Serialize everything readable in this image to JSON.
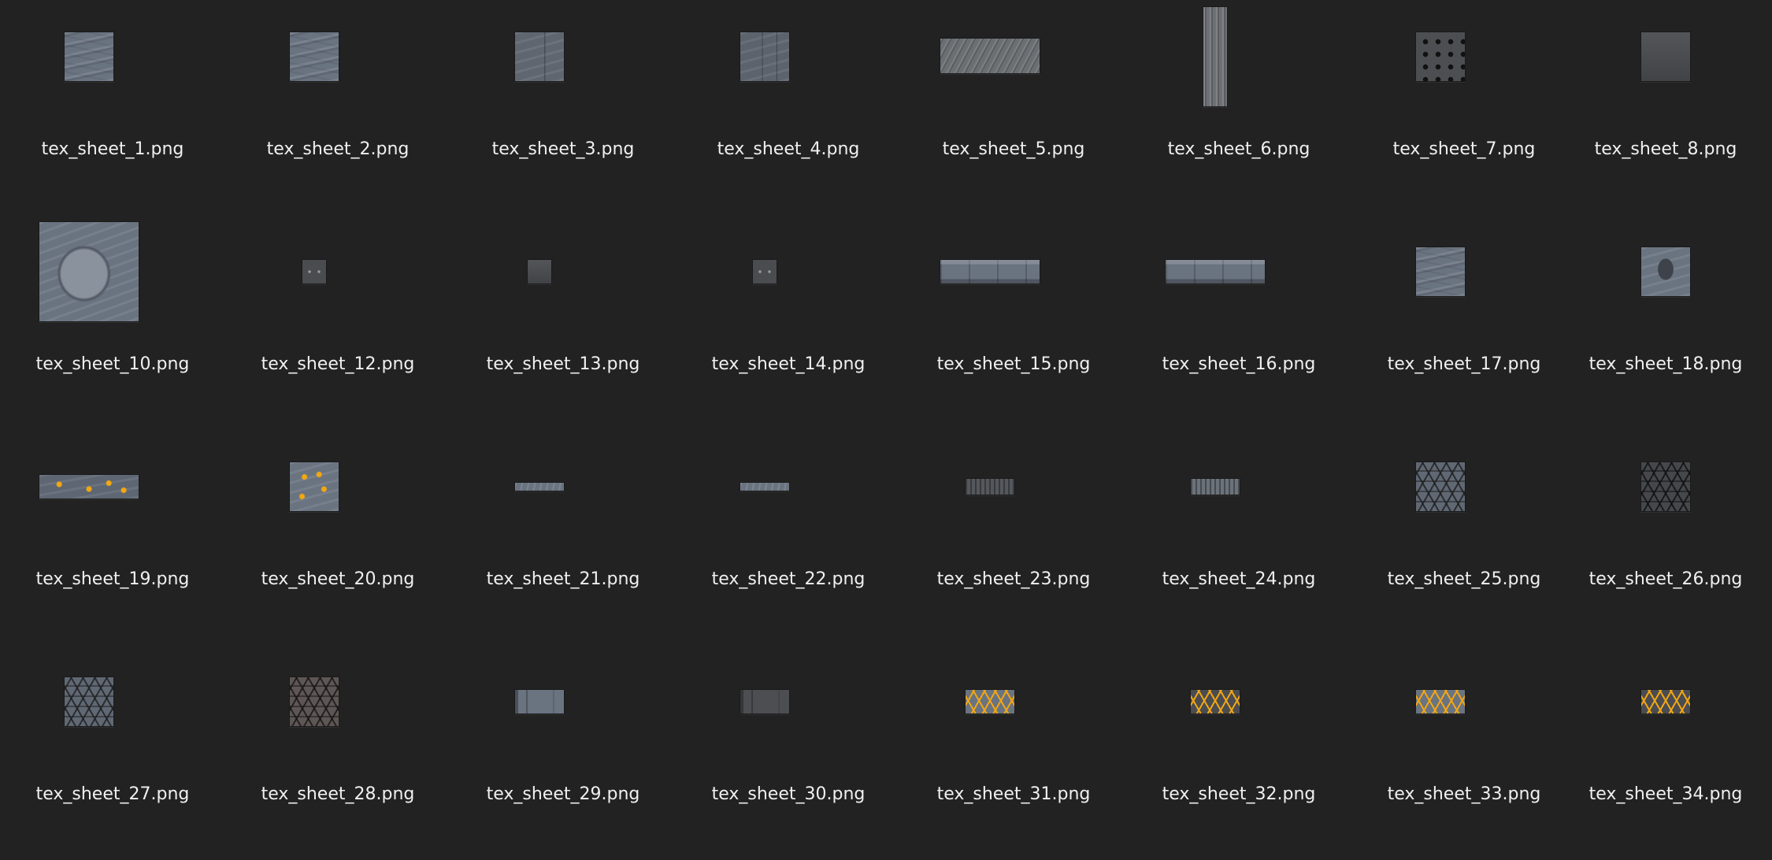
{
  "files": [
    {
      "name": "tex_sheet_1.png",
      "texture": "stone"
    },
    {
      "name": "tex_sheet_2.png",
      "texture": "stone"
    },
    {
      "name": "tex_sheet_3.png",
      "texture": "panel"
    },
    {
      "name": "tex_sheet_4.png",
      "texture": "panel-2"
    },
    {
      "name": "tex_sheet_5.png",
      "texture": "plank"
    },
    {
      "name": "tex_sheet_6.png",
      "texture": "plank-vertical"
    },
    {
      "name": "tex_sheet_7.png",
      "texture": "dots"
    },
    {
      "name": "tex_sheet_8.png",
      "texture": "metal-dark"
    },
    {
      "name": "tex_sheet_10.png",
      "texture": "boulder"
    },
    {
      "name": "tex_sheet_12.png",
      "texture": "small-dark"
    },
    {
      "name": "tex_sheet_13.png",
      "texture": "metal-dark"
    },
    {
      "name": "tex_sheet_14.png",
      "texture": "small-dark"
    },
    {
      "name": "tex_sheet_15.png",
      "texture": "bar"
    },
    {
      "name": "tex_sheet_16.png",
      "texture": "bar"
    },
    {
      "name": "tex_sheet_17.png",
      "texture": "stone"
    },
    {
      "name": "tex_sheet_18.png",
      "texture": "shrine"
    },
    {
      "name": "tex_sheet_19.png",
      "texture": "lava"
    },
    {
      "name": "tex_sheet_20.png",
      "texture": "lava-stone"
    },
    {
      "name": "tex_sheet_21.png",
      "texture": "thin"
    },
    {
      "name": "tex_sheet_22.png",
      "texture": "thin"
    },
    {
      "name": "tex_sheet_23.png",
      "texture": "grate"
    },
    {
      "name": "tex_sheet_24.png",
      "texture": "grate-light"
    },
    {
      "name": "tex_sheet_25.png",
      "texture": "hex"
    },
    {
      "name": "tex_sheet_26.png",
      "texture": "hex-dark"
    },
    {
      "name": "tex_sheet_27.png",
      "texture": "hex"
    },
    {
      "name": "tex_sheet_28.png",
      "texture": "hex-brown"
    },
    {
      "name": "tex_sheet_29.png",
      "texture": "block"
    },
    {
      "name": "tex_sheet_30.png",
      "texture": "block-dark"
    },
    {
      "name": "tex_sheet_31.png",
      "texture": "hex-gold"
    },
    {
      "name": "tex_sheet_32.png",
      "texture": "hex-gold-dark"
    },
    {
      "name": "tex_sheet_33.png",
      "texture": "hex-gold"
    },
    {
      "name": "tex_sheet_34.png",
      "texture": "hex-gold-dark"
    }
  ],
  "colors": {
    "background": "#222222",
    "label_text": "#f0f0f0",
    "accent_gold": "#f2a712"
  }
}
